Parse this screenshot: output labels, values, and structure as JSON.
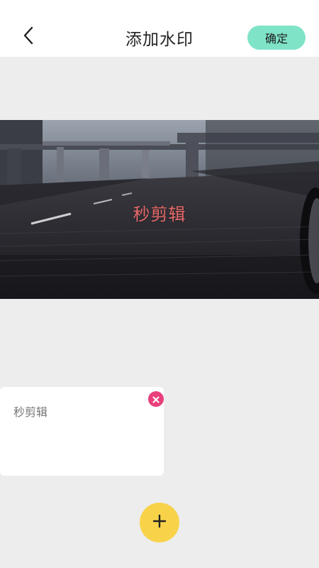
{
  "header": {
    "title": "添加水印",
    "confirm_label": "确定",
    "back_icon": "chevron-left-icon"
  },
  "preview": {
    "watermark_text": "秒剪辑",
    "watermark_color": "#e86a6a"
  },
  "watermark_list": {
    "items": [
      {
        "text": "秒剪辑",
        "remove_icon": "close-icon"
      }
    ]
  },
  "add_button": {
    "icon": "plus-icon",
    "color": "#f8d34a"
  },
  "colors": {
    "accent": "#7fe3c8",
    "delete": "#e83f7c",
    "background": "#ededed"
  }
}
